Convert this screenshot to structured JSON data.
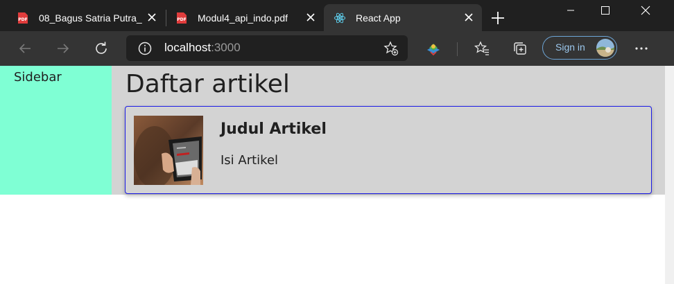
{
  "browser": {
    "tabs": [
      {
        "title": "08_Bagus Satria Putra_",
        "icon": "pdf-icon"
      },
      {
        "title": "Modul4_api_indo.pdf",
        "icon": "pdf-icon"
      },
      {
        "title": "React App",
        "icon": "react-icon"
      }
    ],
    "address": {
      "host": "localhost",
      "port": ":3000"
    },
    "sign_in_label": "Sign in",
    "colors": {
      "tabstrip": "#202020",
      "toolbar": "#343434",
      "accent": "#6ea6d8"
    }
  },
  "page": {
    "sidebar_label": "Sidebar",
    "heading": "Daftar artikel",
    "articles": [
      {
        "title": "Judul Artikel",
        "body": "Isi Artikel",
        "image": "tablet-photo"
      }
    ],
    "colors": {
      "sidebar_bg": "#7fffd4",
      "main_bg": "#d3d3d3",
      "card_border": "#1a1ae6"
    }
  }
}
